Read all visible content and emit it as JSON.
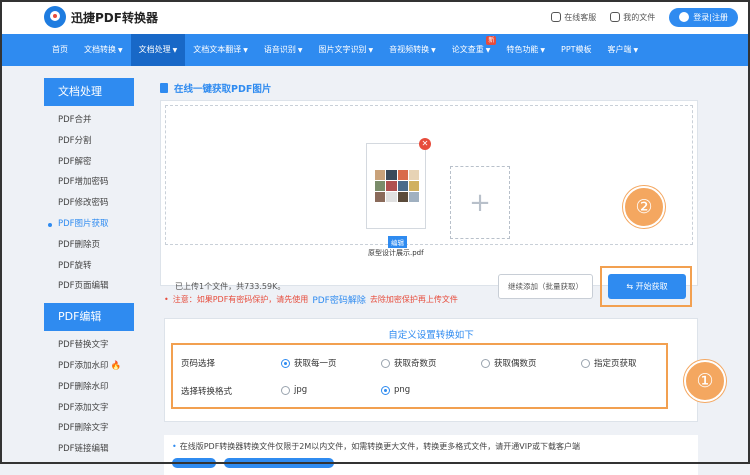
{
  "brand": {
    "name": "迅捷PDF转换器"
  },
  "topbar": {
    "service_label": "在线客服",
    "files_label": "我的文件",
    "login_label": "登录|注册"
  },
  "nav": {
    "items": [
      {
        "label": "首页",
        "caret": false
      },
      {
        "label": "文档转换",
        "caret": true
      },
      {
        "label": "文档处理",
        "caret": true
      },
      {
        "label": "文档文本翻译",
        "caret": true
      },
      {
        "label": "语音识别",
        "caret": true
      },
      {
        "label": "图片文字识别",
        "caret": true
      },
      {
        "label": "音视频转换",
        "caret": true
      },
      {
        "label": "论文查重",
        "caret": true
      },
      {
        "label": "特色功能",
        "caret": true
      },
      {
        "label": "PPT模板",
        "caret": false
      },
      {
        "label": "客户端",
        "caret": true
      }
    ],
    "new_badge": "新"
  },
  "sidebar": {
    "group1_title": "文档处理",
    "group1_items": [
      "PDF合并",
      "PDF分割",
      "PDF解密",
      "PDF增加密码",
      "PDF修改密码",
      "PDF图片获取",
      "PDF删除页",
      "PDF旋转",
      "PDF页面编辑"
    ],
    "group2_title": "PDF编辑",
    "group2_items": [
      "PDF替换文字",
      "PDF添加水印",
      "PDF删除水印",
      "PDF添加文字",
      "PDF删除文字",
      "PDF链接编辑"
    ]
  },
  "main": {
    "title": "在线一键获取PDF图片",
    "file": {
      "name": "原型设计展示.pdf",
      "edit_label": "编辑"
    },
    "status": "已上传1个文件，共733.59K。",
    "continue_label": "继续添加（批量获取）",
    "start_label": "开始获取",
    "warning_prefix": "注意：如果PDF有密码保护，请先使用",
    "warning_link": "PDF密码解除",
    "warning_suffix": "去除加密保护再上传文件",
    "settings_title": "自定义设置转换如下",
    "page_label": "页码选择",
    "page_options": [
      "获取每一页",
      "获取奇数页",
      "获取偶数页",
      "指定页获取"
    ],
    "page_selected": "获取每一页",
    "format_label": "选择转换格式",
    "format_options": [
      "jpg",
      "png"
    ],
    "format_selected": "png",
    "footer_note": "在线版PDF转换器转换文件仅限于2M以内文件，如需转换更大文件，转换更多格式文件，请开通VIP或下载客户端"
  },
  "callouts": {
    "one": "①",
    "two": "②"
  },
  "colors": {
    "primary": "#2f8bf0",
    "nav_active": "#1868c7",
    "highlight": "#f2a050",
    "warning": "#e74c3c"
  }
}
